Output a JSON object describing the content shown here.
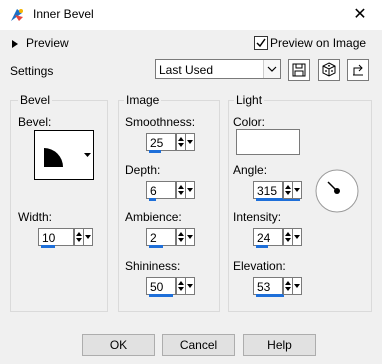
{
  "window": {
    "title": "Inner Bevel",
    "close_icon": "close-icon"
  },
  "preview": {
    "label": "Preview",
    "preview_on_image_label": "Preview on Image",
    "preview_on_image_checked": true
  },
  "settings": {
    "label": "Settings",
    "preset_value": "Last Used"
  },
  "bevel": {
    "group_label": "Bevel",
    "bevel_label": "Bevel:",
    "width_label": "Width:",
    "width_value": "10"
  },
  "image": {
    "group_label": "Image",
    "smoothness_label": "Smoothness:",
    "smoothness_value": "25",
    "depth_label": "Depth:",
    "depth_value": "6",
    "ambience_label": "Ambience:",
    "ambience_value": "2",
    "shininess_label": "Shininess:",
    "shininess_value": "50"
  },
  "light": {
    "group_label": "Light",
    "color_label": "Color:",
    "color": "#ffffff",
    "angle_label": "Angle:",
    "angle_value": "315",
    "intensity_label": "Intensity:",
    "intensity_value": "24",
    "elevation_label": "Elevation:",
    "elevation_value": "53"
  },
  "buttons": {
    "ok": "OK",
    "cancel": "Cancel",
    "help": "Help"
  },
  "colors": {
    "accent": "#1e6fd9",
    "brand_icon": "#1b6fc4"
  }
}
